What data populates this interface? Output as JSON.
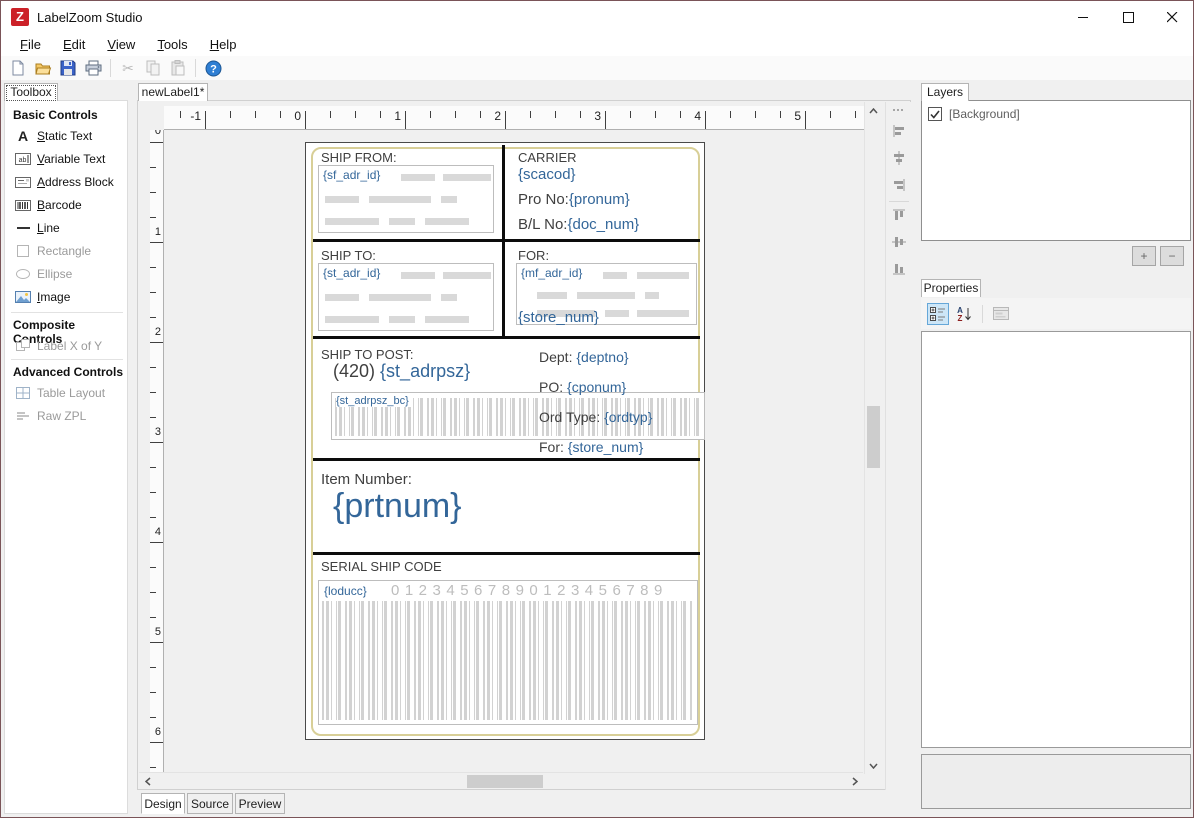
{
  "colors": {
    "accent_blue": "#336699",
    "label_border_khaki": "#d8cf97",
    "placeholder_gray": "#d9d9d9",
    "logo_red": "#cc2128"
  },
  "window": {
    "title": "LabelZoom Studio",
    "logo_letter": "Z"
  },
  "menu": {
    "items": [
      {
        "label": "File"
      },
      {
        "label": "Edit"
      },
      {
        "label": "View"
      },
      {
        "label": "Tools"
      },
      {
        "label": "Help"
      }
    ]
  },
  "toolbox": {
    "title": "Toolbox",
    "sections": [
      {
        "header": "Basic Controls",
        "items": [
          {
            "label": "Static Text",
            "enabled": true
          },
          {
            "label": "Variable Text",
            "enabled": true
          },
          {
            "label": "Address Block",
            "enabled": true
          },
          {
            "label": "Barcode",
            "enabled": true
          },
          {
            "label": "Line",
            "enabled": true
          },
          {
            "label": "Rectangle",
            "enabled": false
          },
          {
            "label": "Ellipse",
            "enabled": false
          },
          {
            "label": "Image",
            "enabled": true
          }
        ]
      },
      {
        "header": "Composite Controls",
        "items": [
          {
            "label": "Label X of Y",
            "enabled": false
          }
        ]
      },
      {
        "header": "Advanced Controls",
        "items": [
          {
            "label": "Table Layout",
            "enabled": false
          },
          {
            "label": "Raw ZPL",
            "enabled": false
          }
        ]
      }
    ]
  },
  "editor": {
    "tab": "newLabel1*",
    "h_ruler": [
      "-1",
      "0",
      "1",
      "2",
      "3",
      "4",
      "5"
    ],
    "v_ruler": [
      "0",
      "1",
      "2",
      "3",
      "4",
      "5",
      "6"
    ],
    "bottom_tabs": [
      "Design",
      "Source",
      "Preview"
    ]
  },
  "label": {
    "ship_from": {
      "title": "SHIP FROM:",
      "field": "{sf_adr_id}"
    },
    "carrier": {
      "title": "CARRIER",
      "scac": "{scacod}",
      "pro_label": "Pro No:",
      "pro": "{pronum}",
      "bl_label": "B/L No:",
      "bl": "{doc_num}"
    },
    "ship_to": {
      "title": "SHIP TO:",
      "field": "{st_adr_id}"
    },
    "for_block": {
      "title": "FOR:",
      "field": "{mf_adr_id}",
      "store": "{store_num}"
    },
    "post": {
      "title": "SHIP TO POST:",
      "prefix": "(420)",
      "value": "{st_adrpsz}",
      "barcode_label": "{st_adrpsz_bc}"
    },
    "details": {
      "dept_label": "Dept:",
      "dept": "{deptno}",
      "po_label": "PO:",
      "po": "{cponum}",
      "ord_label": "Ord Type:",
      "ord": "{ordtyp}",
      "for_label": "For:",
      "for_value": "{store_num}"
    },
    "item": {
      "label": "Item Number:",
      "value": "{prtnum}"
    },
    "serial": {
      "title": "SERIAL SHIP CODE",
      "field": "{loducc}",
      "digits": "01234567890123456789"
    }
  },
  "layers": {
    "tab": "Layers",
    "items": [
      {
        "label": "[Background]",
        "checked": true
      }
    ],
    "add_label": "+",
    "remove_label": "−"
  },
  "properties": {
    "tab": "Properties"
  }
}
